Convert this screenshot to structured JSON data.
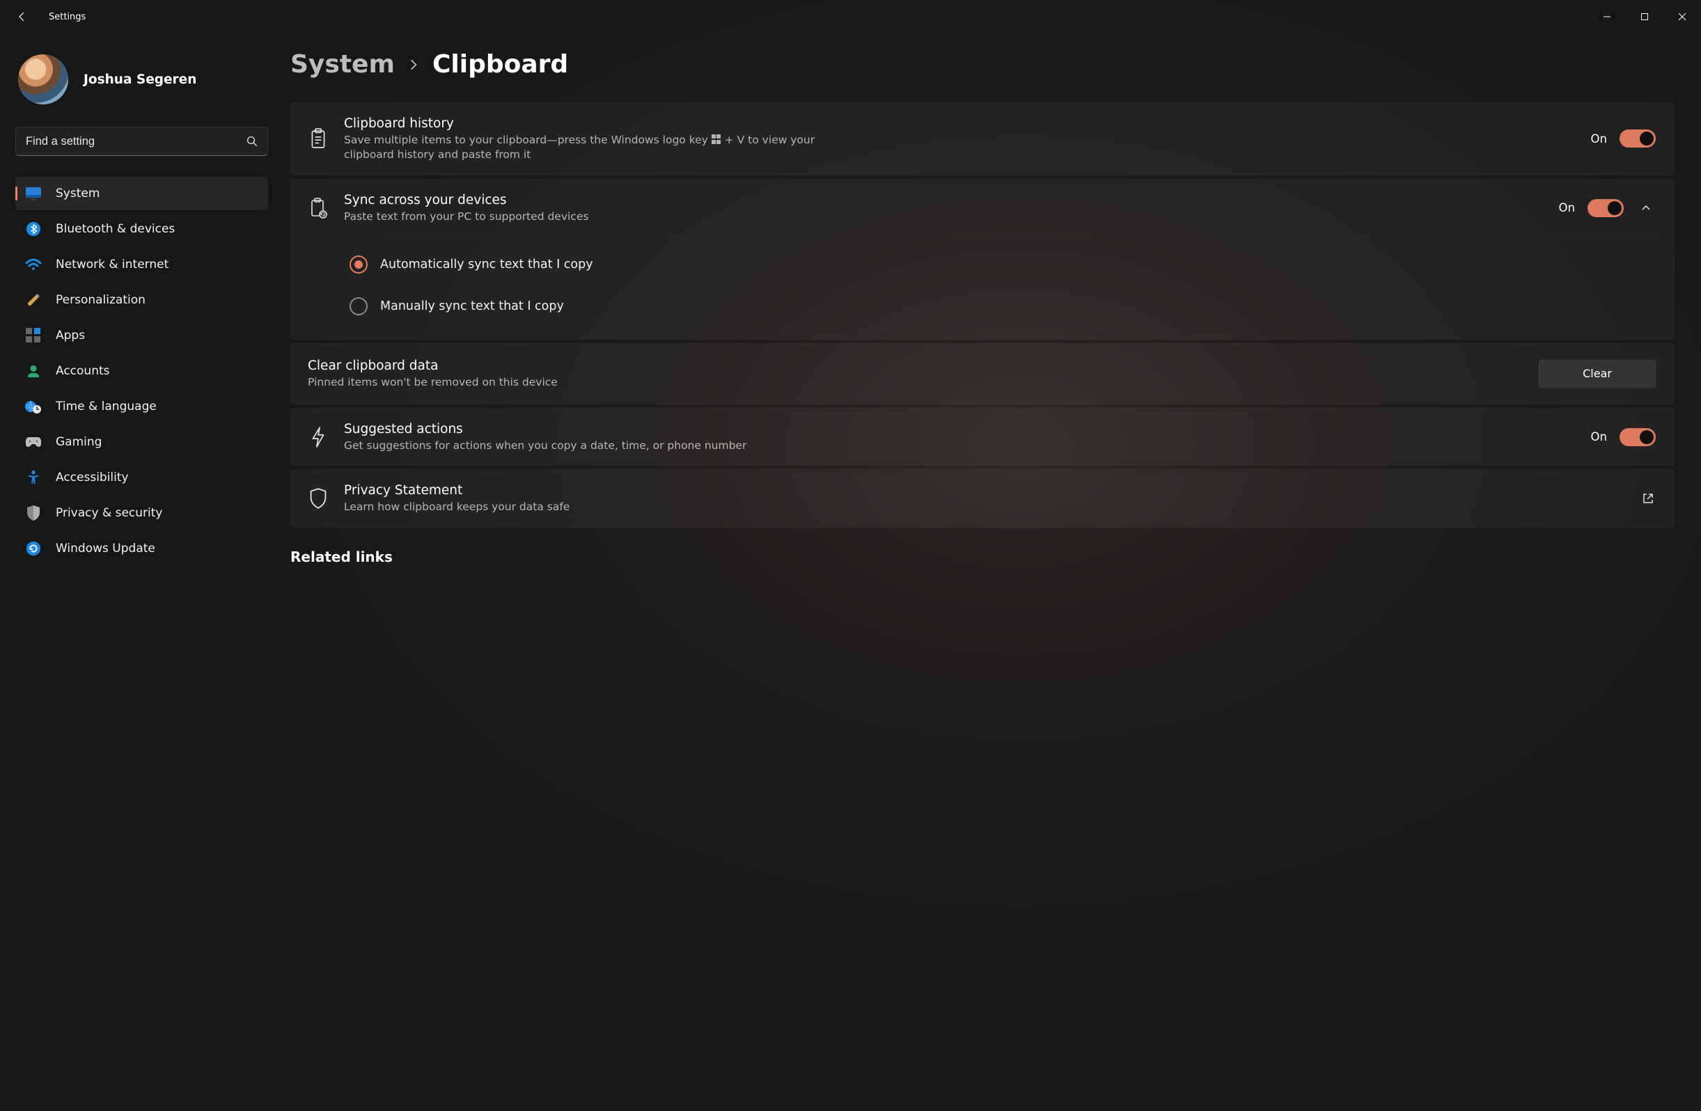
{
  "titlebar": {
    "title": "Settings"
  },
  "user": {
    "name": "Joshua Segeren"
  },
  "search": {
    "placeholder": "Find a setting"
  },
  "nav": {
    "items": [
      {
        "id": "system",
        "label": "System"
      },
      {
        "id": "bluetooth",
        "label": "Bluetooth & devices"
      },
      {
        "id": "network",
        "label": "Network & internet"
      },
      {
        "id": "personalization",
        "label": "Personalization"
      },
      {
        "id": "apps",
        "label": "Apps"
      },
      {
        "id": "accounts",
        "label": "Accounts"
      },
      {
        "id": "time",
        "label": "Time & language"
      },
      {
        "id": "gaming",
        "label": "Gaming"
      },
      {
        "id": "accessibility",
        "label": "Accessibility"
      },
      {
        "id": "privacy",
        "label": "Privacy & security"
      },
      {
        "id": "update",
        "label": "Windows Update"
      }
    ],
    "selected": "system"
  },
  "breadcrumb": {
    "section": "System",
    "page": "Clipboard"
  },
  "clipboard_history": {
    "title": "Clipboard history",
    "sub_before": "Save multiple items to your clipboard—press the Windows logo key ",
    "sub_after": " + V to view your clipboard history and paste from it",
    "state": "On"
  },
  "sync": {
    "title": "Sync across your devices",
    "sub": "Paste text from your PC to supported devices",
    "state": "On",
    "options": [
      {
        "label": "Automatically sync text that I copy",
        "checked": true
      },
      {
        "label": "Manually sync text that I copy",
        "checked": false
      }
    ]
  },
  "clear": {
    "title": "Clear clipboard data",
    "sub": "Pinned items won't be removed on this device",
    "button": "Clear"
  },
  "suggested": {
    "title": "Suggested actions",
    "sub": "Get suggestions for actions when you copy a date, time, or phone number",
    "state": "On"
  },
  "privacy_statement": {
    "title": "Privacy Statement",
    "sub": "Learn how clipboard keeps your data safe"
  },
  "related": {
    "title": "Related links"
  }
}
